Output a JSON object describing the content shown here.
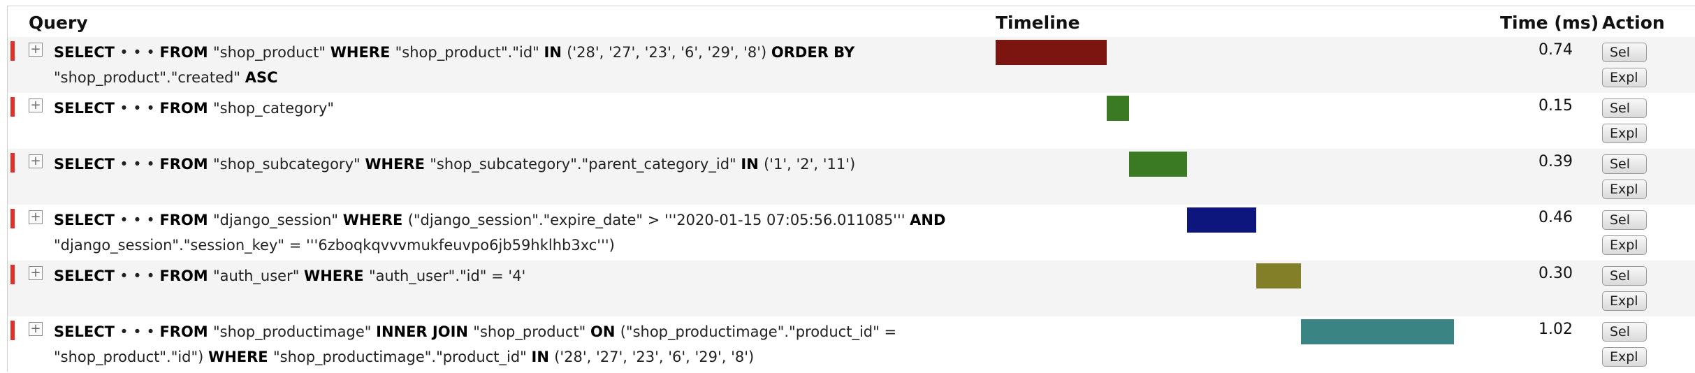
{
  "header": {
    "query": "Query",
    "timeline": "Timeline",
    "time": "Time (ms)",
    "action": "Action"
  },
  "buttons": {
    "sel": "Sel",
    "expl": "Expl"
  },
  "expand_glyph": "+",
  "rows": [
    {
      "line1": [
        {
          "t": "SELECT ",
          "b": true
        },
        {
          "t": "• • • ",
          "b": false
        },
        {
          "t": "FROM ",
          "b": true
        },
        {
          "t": "\"shop_product\" ",
          "b": false
        },
        {
          "t": "WHERE ",
          "b": true
        },
        {
          "t": "\"shop_product\".\"id\" ",
          "b": false
        },
        {
          "t": "IN ",
          "b": true
        },
        {
          "t": "('28', '27', '23', '6', '29', '8') ",
          "b": false
        },
        {
          "t": "ORDER BY",
          "b": true
        }
      ],
      "line2": [
        {
          "t": "\"shop_product\".\"created\" ",
          "b": false
        },
        {
          "t": "ASC",
          "b": true
        }
      ],
      "time": "0.74",
      "bar_color": "#7c1410",
      "bar_start_fraction": 0.0,
      "bar_width_fraction": 0.2266
    },
    {
      "line1": [
        {
          "t": "SELECT ",
          "b": true
        },
        {
          "t": "• • • ",
          "b": false
        },
        {
          "t": "FROM ",
          "b": true
        },
        {
          "t": "\"shop_category\"",
          "b": false
        }
      ],
      "line2": [],
      "time": "0.15",
      "bar_color": "#3a7a22",
      "bar_start_fraction": 0.2266,
      "bar_width_fraction": 0.0459
    },
    {
      "line1": [
        {
          "t": "SELECT ",
          "b": true
        },
        {
          "t": "• • • ",
          "b": false
        },
        {
          "t": "FROM ",
          "b": true
        },
        {
          "t": "\"shop_subcategory\" ",
          "b": false
        },
        {
          "t": "WHERE ",
          "b": true
        },
        {
          "t": "\"shop_subcategory\".\"parent_category_id\" ",
          "b": false
        },
        {
          "t": "IN ",
          "b": true
        },
        {
          "t": "('1', '2', '11')",
          "b": false
        }
      ],
      "line2": [],
      "time": "0.39",
      "bar_color": "#3a7a22",
      "bar_start_fraction": 0.2725,
      "bar_width_fraction": 0.1194
    },
    {
      "line1": [
        {
          "t": "SELECT ",
          "b": true
        },
        {
          "t": "• • • ",
          "b": false
        },
        {
          "t": "FROM ",
          "b": true
        },
        {
          "t": "\"django_session\" ",
          "b": false
        },
        {
          "t": "WHERE ",
          "b": true
        },
        {
          "t": "(\"django_session\".\"expire_date\" > '''2020-01-15 07:05:56.011085''' ",
          "b": false
        },
        {
          "t": "AND",
          "b": true
        }
      ],
      "line2": [
        {
          "t": "\"django_session\".\"session_key\" = '''6zboqkqvvvmukfeuvpo6jb59hklhb3xc''')",
          "b": false
        }
      ],
      "time": "0.46",
      "bar_color": "#0c167c",
      "bar_start_fraction": 0.3919,
      "bar_width_fraction": 0.1408
    },
    {
      "line1": [
        {
          "t": "SELECT ",
          "b": true
        },
        {
          "t": "• • • ",
          "b": false
        },
        {
          "t": "FROM ",
          "b": true
        },
        {
          "t": "\"auth_user\" ",
          "b": false
        },
        {
          "t": "WHERE ",
          "b": true
        },
        {
          "t": "\"auth_user\".\"id\" = '4'",
          "b": false
        }
      ],
      "line2": [],
      "time": "0.30",
      "bar_color": "#827f28",
      "bar_start_fraction": 0.5327,
      "bar_width_fraction": 0.0918
    },
    {
      "line1": [
        {
          "t": "SELECT ",
          "b": true
        },
        {
          "t": "• • • ",
          "b": false
        },
        {
          "t": "FROM ",
          "b": true
        },
        {
          "t": "\"shop_productimage\" ",
          "b": false
        },
        {
          "t": "INNER JOIN ",
          "b": true
        },
        {
          "t": "\"shop_product\" ",
          "b": false
        },
        {
          "t": "ON ",
          "b": true
        },
        {
          "t": "(\"shop_productimage\".\"product_id\" =",
          "b": false
        }
      ],
      "line2": [
        {
          "t": "\"shop_product\".\"id\") ",
          "b": false
        },
        {
          "t": "WHERE ",
          "b": true
        },
        {
          "t": "\"shop_productimage\".\"product_id\" ",
          "b": false
        },
        {
          "t": "IN ",
          "b": true
        },
        {
          "t": "('28', '27', '23', '6', '29', '8')",
          "b": false
        }
      ],
      "time": "1.02",
      "bar_color": "#3a8484",
      "bar_start_fraction": 0.6245,
      "bar_width_fraction": 0.3122
    }
  ]
}
